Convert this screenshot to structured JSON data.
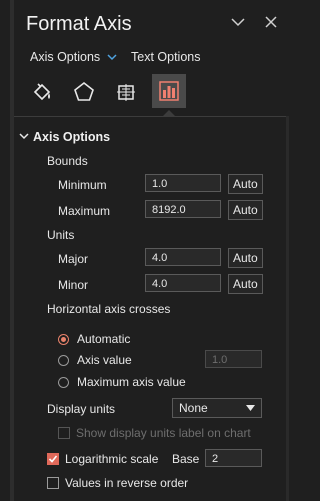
{
  "header": {
    "title": "Format Axis",
    "subtabs": [
      {
        "label": "Axis Options",
        "dropdown": true
      },
      {
        "label": "Text Options",
        "dropdown": false
      }
    ]
  },
  "icon_tabs": [
    {
      "name": "fill-line-icon",
      "selected": false
    },
    {
      "name": "effects-pentagon-icon",
      "selected": false
    },
    {
      "name": "size-properties-icon",
      "selected": false
    },
    {
      "name": "axis-options-chart-icon",
      "selected": true
    }
  ],
  "axis_options": {
    "section_label": "Axis Options",
    "bounds_label": "Bounds",
    "minimum": {
      "label": "Minimum",
      "value": "1.0",
      "auto": "Auto"
    },
    "maximum": {
      "label": "Maximum",
      "value": "8192.0",
      "auto": "Auto"
    },
    "units_label": "Units",
    "major": {
      "label": "Major",
      "value": "4.0",
      "auto": "Auto"
    },
    "minor": {
      "label": "Minor",
      "value": "4.0",
      "auto": "Auto"
    },
    "crosses_label": "Horizontal axis crosses",
    "crosses_options": [
      {
        "label": "Automatic",
        "selected": true
      },
      {
        "label": "Axis value",
        "selected": false,
        "value": "1.0"
      },
      {
        "label": "Maximum axis value",
        "selected": false
      }
    ],
    "display_units_label": "Display units",
    "display_units_value": "None",
    "show_units_label": "Show display units label on chart",
    "log_scale_label": "Logarithmic scale",
    "log_scale_checked": true,
    "base_label": "Base",
    "base_value": "2",
    "reverse_label": "Values in reverse order",
    "reverse_checked": false
  },
  "colors": {
    "accent": "#e0695a",
    "panel_bg": "#1f1f1f",
    "selected_tab_bg": "#4a4a4a"
  }
}
